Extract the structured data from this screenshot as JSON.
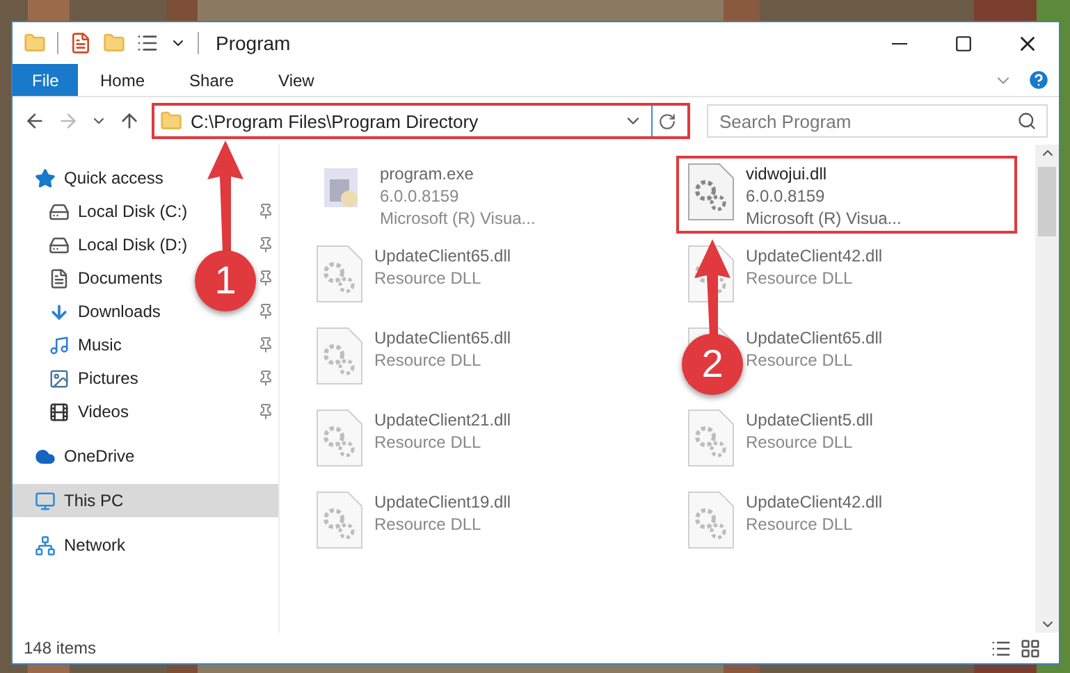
{
  "window": {
    "title": "Program"
  },
  "ribbon": {
    "tabs": [
      {
        "label": "File",
        "selected": true
      },
      {
        "label": "Home",
        "selected": false
      },
      {
        "label": "Share",
        "selected": false
      },
      {
        "label": "View",
        "selected": false
      }
    ]
  },
  "address_bar": {
    "path": "C:\\Program Files\\Program Directory",
    "highlighted": true
  },
  "search": {
    "placeholder": "Search Program"
  },
  "sidebar": {
    "items": [
      {
        "label": "Quick access",
        "kind": "star",
        "selected": false,
        "children": [
          {
            "label": "Local Disk (C:)",
            "kind": "disk-c",
            "pinned": true,
            "selected": false
          },
          {
            "label": "Local Disk (D:)",
            "kind": "disk",
            "pinned": true,
            "selected": false
          },
          {
            "label": "Documents",
            "kind": "document",
            "pinned": true,
            "selected": false
          },
          {
            "label": "Downloads",
            "kind": "download",
            "pinned": true,
            "selected": false
          },
          {
            "label": "Music",
            "kind": "music",
            "pinned": true,
            "selected": false
          },
          {
            "label": "Pictures",
            "kind": "pictures",
            "pinned": true,
            "selected": false
          },
          {
            "label": "Videos",
            "kind": "video",
            "pinned": true,
            "selected": false
          }
        ]
      },
      {
        "label": "OneDrive",
        "kind": "cloud",
        "selected": false
      },
      {
        "label": "This PC",
        "kind": "pc",
        "selected": true
      },
      {
        "label": "Network",
        "kind": "network",
        "selected": false
      }
    ]
  },
  "files": [
    {
      "name": "program.exe",
      "line_2": "6.0.0.8159",
      "line_3": "Microsoft (R) Visua...",
      "kind": "exe",
      "blurred": true,
      "highlighted": false
    },
    {
      "name": "vidwojui.dll",
      "line_2": "6.0.0.8159",
      "line_3": "Microsoft (R) Visua...",
      "kind": "dll",
      "blurred": false,
      "highlighted": true
    },
    {
      "name": "UpdateClient65.dll",
      "line_2": "Resource DLL",
      "kind": "dll",
      "blurred": true,
      "highlighted": false
    },
    {
      "name": "UpdateClient42.dll",
      "line_2": "Resource DLL",
      "kind": "dll",
      "blurred": true,
      "highlighted": false
    },
    {
      "name": "UpdateClient65.dll",
      "line_2": "Resource DLL",
      "kind": "dll",
      "blurred": true,
      "highlighted": false
    },
    {
      "name": "UpdateClient65.dll",
      "line_2": "Resource DLL",
      "kind": "dll",
      "blurred": true,
      "highlighted": false
    },
    {
      "name": "UpdateClient21.dll",
      "line_2": "Resource DLL",
      "kind": "dll",
      "blurred": true,
      "highlighted": false
    },
    {
      "name": "UpdateClient5.dll",
      "line_2": "Resource DLL",
      "kind": "dll",
      "blurred": true,
      "highlighted": false
    },
    {
      "name": "UpdateClient19.dll",
      "line_2": "Resource DLL",
      "kind": "dll",
      "blurred": true,
      "highlighted": false
    },
    {
      "name": "UpdateClient42.dll",
      "line_2": "Resource DLL",
      "kind": "dll",
      "blurred": true,
      "highlighted": false
    }
  ],
  "status_bar": {
    "count": "148 items"
  },
  "annotations": [
    {
      "number": "1"
    },
    {
      "number": "2"
    }
  ]
}
